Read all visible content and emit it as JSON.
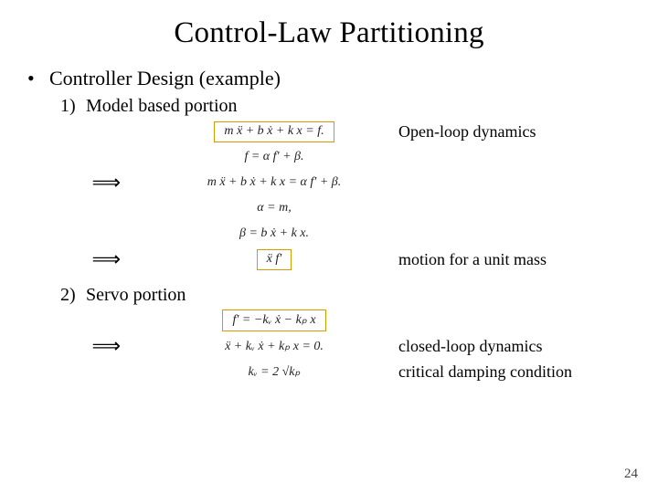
{
  "title": "Control-Law Partitioning",
  "bullet": {
    "dot": "•",
    "text": "Controller Design (example)"
  },
  "sections": {
    "model": {
      "num": "1)",
      "label": "Model based portion"
    },
    "servo": {
      "num": "2)",
      "label": "Servo portion"
    }
  },
  "labels": {
    "open_loop": "Open-loop dynamics",
    "unit_mass": "motion for a unit mass",
    "closed_loop": "closed-loop dynamics",
    "critical_damping": "critical damping condition"
  },
  "equations": {
    "eq1": "m ẍ + b ẋ + k x = f.",
    "eq2": "f = α f′ + β.",
    "eq3": "m ẍ + b ẋ + k x = α f′ + β.",
    "eq4": "α = m,",
    "eq5": "β = b ẋ + k x.",
    "eq6": "ẍ    f′",
    "eq7": "f′ = −kᵥ ẋ − kₚ x",
    "eq8": "ẍ + kᵥ ẋ + kₚ x = 0.",
    "eq9": "kᵥ = 2 √kₚ"
  },
  "arrow_glyph": "⟹",
  "page_number": "24"
}
